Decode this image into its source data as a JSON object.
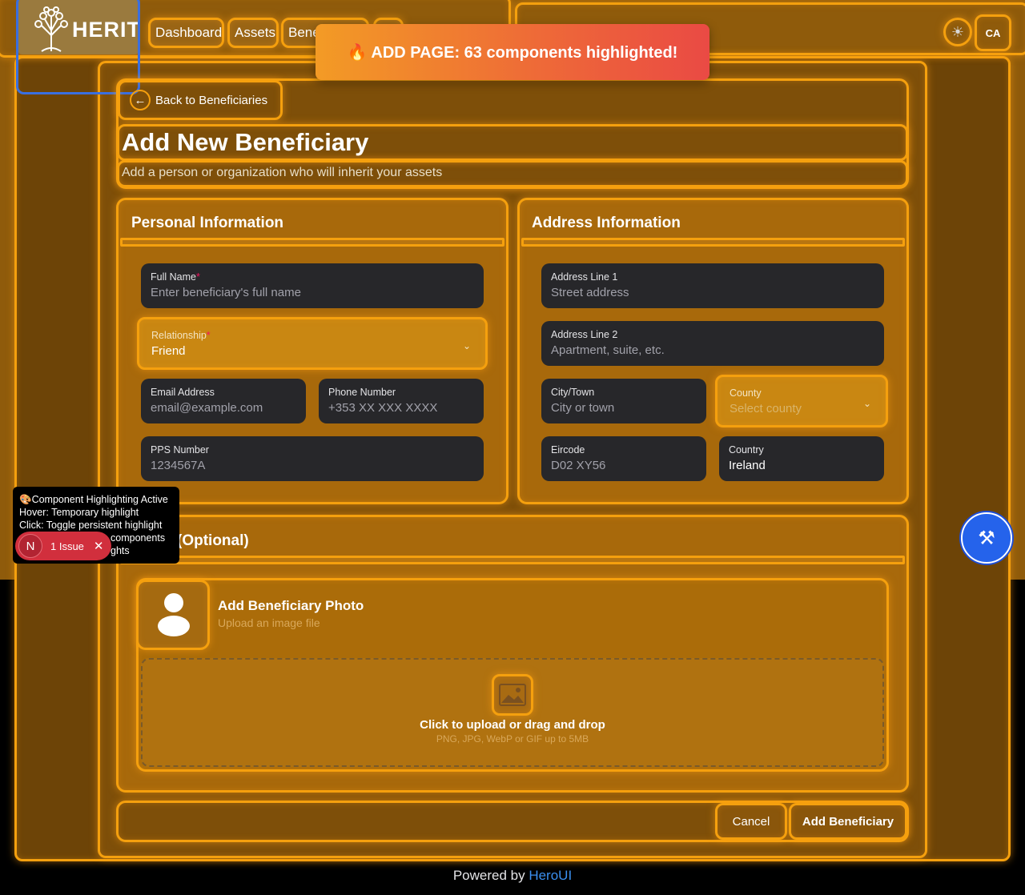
{
  "navbar": {
    "logo_text": "HERIT",
    "links": [
      "Dashboard",
      "Assets",
      "Beneficiaries"
    ],
    "avatar_initials": "CA"
  },
  "banner": {
    "text": "🔥 ADD PAGE: 63 components highlighted!"
  },
  "header": {
    "back_label": "Back to Beneficiaries",
    "title": "Add New Beneficiary",
    "subtitle": "Add a person or organization who will inherit your assets"
  },
  "personal": {
    "title": "Personal Information",
    "full_name": {
      "label": "Full Name",
      "required": "*",
      "placeholder": "Enter beneficiary's full name"
    },
    "relationship": {
      "label": "Relationship",
      "required": "*",
      "value": "Friend"
    },
    "email": {
      "label": "Email Address",
      "placeholder": "email@example.com"
    },
    "phone": {
      "label": "Phone Number",
      "placeholder": "+353 XX XXX XXXX"
    },
    "pps": {
      "label": "PPS Number",
      "placeholder": "1234567A"
    }
  },
  "address": {
    "title": "Address Information",
    "line1": {
      "label": "Address Line 1",
      "placeholder": "Street address"
    },
    "line2": {
      "label": "Address Line 2",
      "placeholder": "Apartment, suite, etc."
    },
    "city": {
      "label": "City/Town",
      "placeholder": "City or town"
    },
    "county": {
      "label": "County",
      "placeholder": "Select county"
    },
    "eircode": {
      "label": "Eircode",
      "placeholder": "D02 XY56"
    },
    "country": {
      "label": "Country",
      "value": "Ireland"
    }
  },
  "photo": {
    "section_title": "(Optional)",
    "heading": "Add Beneficiary Photo",
    "subheading": "Upload an image file",
    "drop_primary": "Click to upload or drag and drop",
    "drop_secondary": "PNG, JPG, WebP or GIF up to 5MB"
  },
  "actions": {
    "cancel": "Cancel",
    "submit": "Add Beneficiary"
  },
  "footer": {
    "powered_prefix": "Powered by",
    "powered_link": "HeroUI"
  },
  "overlay": {
    "tooltip_lines": [
      "🎨Component Highlighting Active",
      "Hover: Temporary highlight",
      "Click: Toggle persistent highlight",
      "components",
      "ghts"
    ],
    "issue_badge": "1 Issue",
    "issue_letter": "N"
  },
  "colors": {
    "highlight": "#f5a00e",
    "field_bg": "#27272a",
    "link": "#3b8ff0",
    "dev_button": "#2563eb"
  }
}
